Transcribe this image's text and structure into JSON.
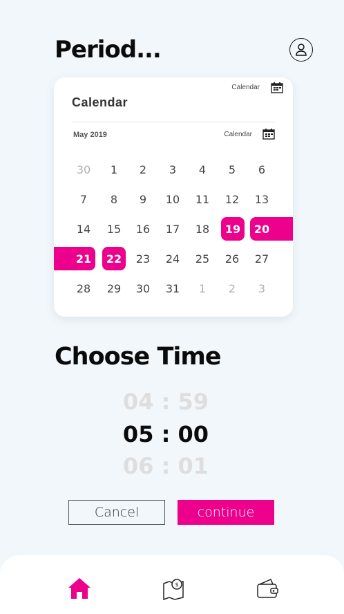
{
  "header": {
    "title": "Period..."
  },
  "card": {
    "top_link": "Calendar",
    "title": "Calendar",
    "month": "May 2019",
    "month_link": "Calendar"
  },
  "calendar": {
    "weeks": [
      [
        "30",
        "1",
        "2",
        "3",
        "4",
        "5",
        "6"
      ],
      [
        "7",
        "8",
        "9",
        "10",
        "11",
        "12",
        "13"
      ],
      [
        "14",
        "15",
        "16",
        "17",
        "18",
        "19",
        "20"
      ],
      [
        "21",
        "22",
        "23",
        "24",
        "25",
        "26",
        "27"
      ],
      [
        "28",
        "29",
        "30",
        "31",
        "1",
        "2",
        "3"
      ]
    ],
    "selected": [
      "19",
      "20",
      "21",
      "22"
    ],
    "accent": "#ec008c"
  },
  "time_section": {
    "title": "Choose Time",
    "prev": "04 : 59",
    "current": "05 : 00",
    "next": "06 : 01"
  },
  "actions": {
    "cancel": "Cancel",
    "continue": "continue"
  },
  "nav": {
    "items": [
      "home-icon",
      "map-icon",
      "wallet-icon"
    ]
  }
}
